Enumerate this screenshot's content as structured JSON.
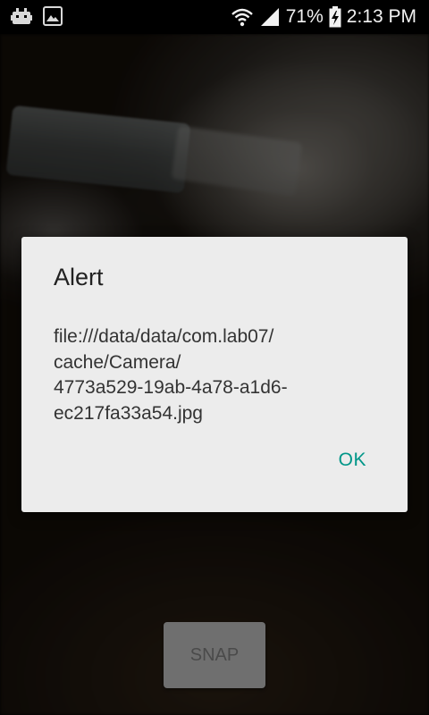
{
  "status_bar": {
    "notification_icons": [
      "android-debug-icon",
      "image-icon"
    ],
    "battery_percent": "71%",
    "time": "2:13 PM"
  },
  "dialog": {
    "title": "Alert",
    "message": "file:///data/data/com.lab07/\ncache/Camera/\n4773a529-19ab-4a78-a1d6-\nec217fa33a54.jpg",
    "ok_label": "OK",
    "ok_color": "#009688"
  },
  "snap_button": {
    "label": "SNAP"
  }
}
